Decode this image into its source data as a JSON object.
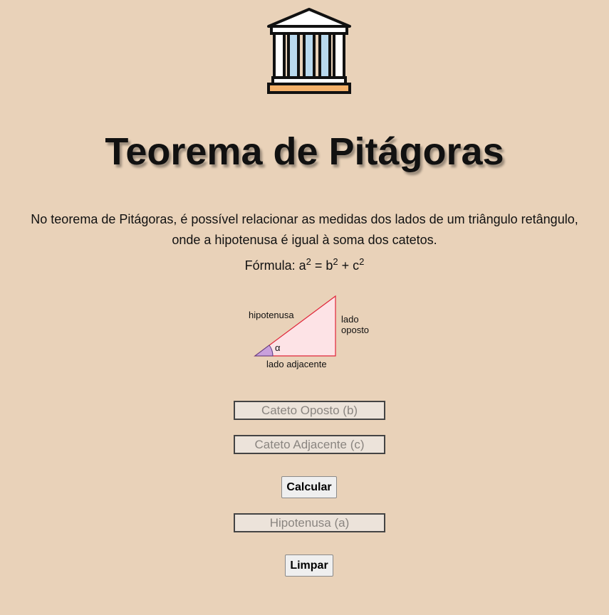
{
  "logo": {
    "icon": "greek-temple-icon"
  },
  "title": "Teorema de Pitágoras",
  "description": {
    "line1": "No teorema de Pitágoras, é possível relacionar as medidas dos lados de um triângulo retângulo,",
    "line2": "onde a hipotenusa é igual à soma dos catetos."
  },
  "formula": {
    "prefix": "Fórmula: ",
    "a": "a",
    "exp_a": "2",
    "equals": " = ",
    "b": "b",
    "exp_b": "2",
    "plus": " + ",
    "c": "c",
    "exp_c": "2"
  },
  "diagram": {
    "hypotenuse": "hipotenusa",
    "opposite_line1": "lado",
    "opposite_line2": "oposto",
    "adjacent": "lado adjacente",
    "angle": "α",
    "colors": {
      "triangle_fill": "#fde3e6",
      "triangle_stroke": "#e0263a",
      "angle_fill": "#c9a0dc"
    }
  },
  "inputs": {
    "opposite_placeholder": "Cateto Oposto (b)",
    "opposite_value": "",
    "adjacent_placeholder": "Cateto Adjacente (c)",
    "adjacent_value": "",
    "hypotenuse_placeholder": "Hipotenusa (a)",
    "hypotenuse_value": ""
  },
  "buttons": {
    "calculate": "Calcular",
    "clear": "Limpar"
  },
  "colors": {
    "background": "#e9d2b9",
    "column_blue": "#b9d9ee",
    "base_orange": "#f4b16a"
  }
}
